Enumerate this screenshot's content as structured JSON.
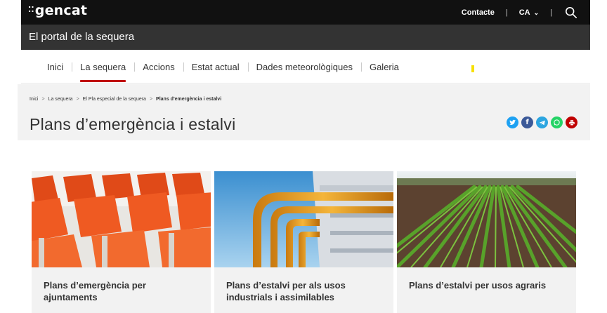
{
  "header": {
    "logo": "gencat",
    "logo_dots": "⁚⁚",
    "contact": "Contacte",
    "lang": "CA",
    "search_icon": "search-icon"
  },
  "portal": {
    "title": "El portal de la sequera"
  },
  "nav": {
    "items": [
      {
        "label": "Inici"
      },
      {
        "label": "La sequera",
        "active": true
      },
      {
        "label": "Accions"
      },
      {
        "label": "Estat actual"
      },
      {
        "label": "Dades meteorològiques"
      },
      {
        "label": "Galeria"
      }
    ],
    "active_color": "#c00000"
  },
  "breadcrumb": {
    "items": [
      "Inici",
      "La sequera",
      "El Pla especial de la sequera",
      "Plans d'emergència i estalvi"
    ]
  },
  "page": {
    "title": "Plans d’emergència i estalvi"
  },
  "share": {
    "icons": [
      {
        "name": "twitter-icon",
        "color": "#1da1f2"
      },
      {
        "name": "facebook-icon",
        "color": "#3b5998"
      },
      {
        "name": "telegram-icon",
        "color": "#2ca5e0"
      },
      {
        "name": "whatsapp-icon",
        "color": "#25d366"
      },
      {
        "name": "print-icon",
        "color": "#c00000"
      }
    ]
  },
  "cards": [
    {
      "title": "Plans d’emergència per ajuntaments",
      "image": "orange-chairs-image"
    },
    {
      "title": "Plans d’estalvi per als usos industrials i assimilables",
      "image": "industrial-pipes-image"
    },
    {
      "title": "Plans d’estalvi per usos agraris",
      "image": "crop-field-image"
    }
  ]
}
